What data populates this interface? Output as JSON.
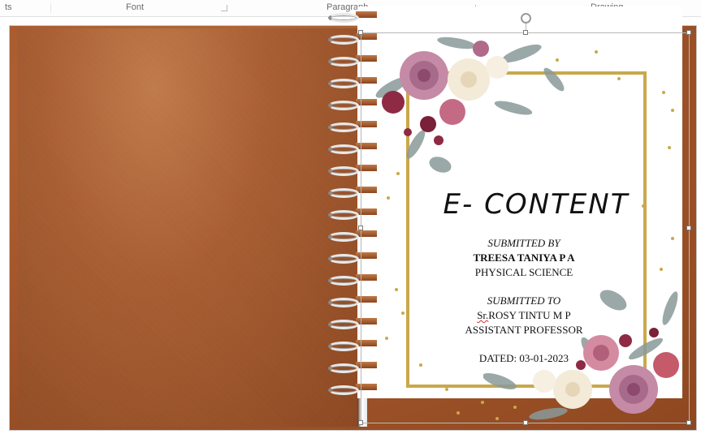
{
  "ribbon": {
    "groups": [
      {
        "label": "ts"
      },
      {
        "label": "Font"
      },
      {
        "label": "Paragraph"
      },
      {
        "label": "Drawing"
      }
    ]
  },
  "cover": {
    "title": "E- CONTENT",
    "submitted_by_label": "SUBMITTED BY",
    "student_name": "TREESA TANIYA P A",
    "subject": "PHYSICAL SCIENCE",
    "submitted_to_label": "SUBMITTED TO",
    "teacher_name": "Sr.ROSY TINTU M P",
    "teacher_title_prefix": "Sr.",
    "teacher_title_rest": "ROSY TINTU M P",
    "teacher_designation": "ASSISTANT PROFESSOR",
    "dated": "DATED: 03-01-2023"
  },
  "colors": {
    "cover_copper": "#a5582c",
    "frame_gold": "#c9a84c",
    "rose_pink": "#c58aa6",
    "burgundy": "#8e2a44",
    "cream_flower": "#f3ead8",
    "leaf_grey": "#8a9a9a"
  }
}
